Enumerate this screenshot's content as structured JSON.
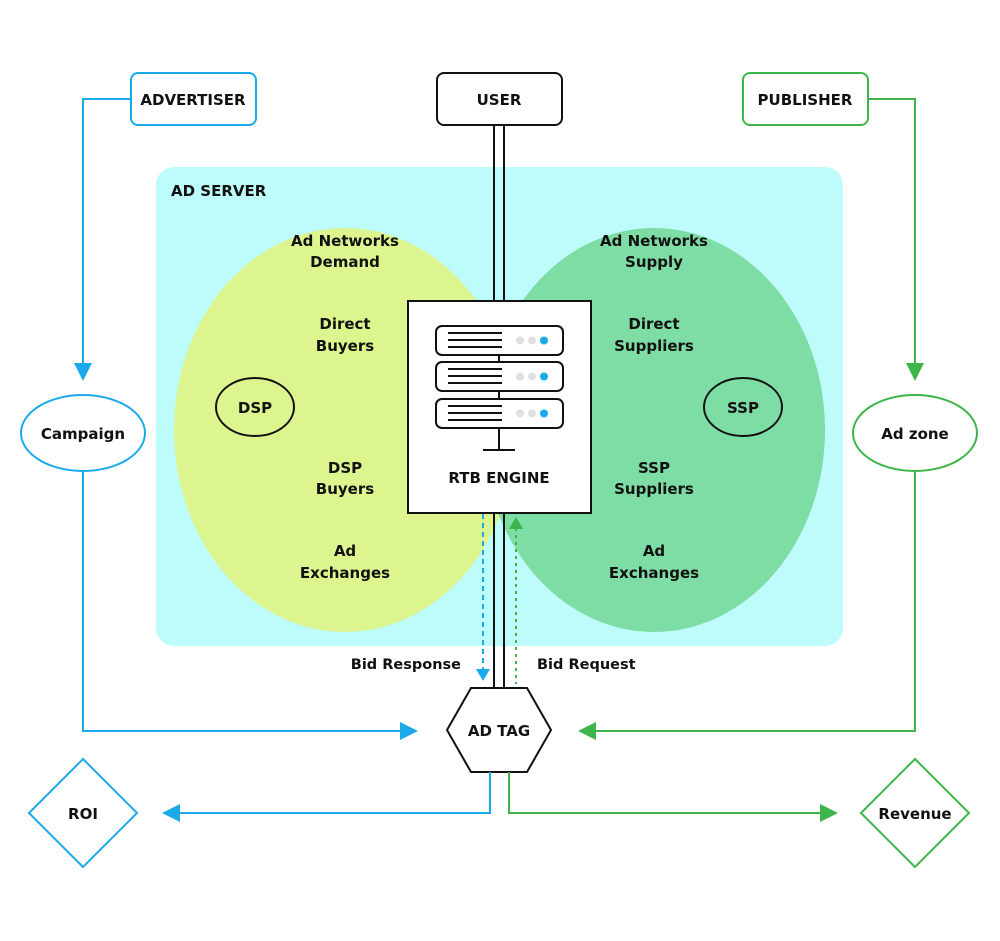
{
  "colors": {
    "blue": "#1AAAE9",
    "green": "#3DB54A",
    "ad_server_bg": "#BEFBFB",
    "demand_circle": "#DCF58F",
    "supply_circle": "#7EDCA5",
    "overlap": "#8DD777",
    "black": "#111111",
    "led_on": "#1AAAE9",
    "led_off": "#E0E0E0"
  },
  "nodes": {
    "advertiser": "ADVERTISER",
    "user": "USER",
    "publisher": "PUBLISHER",
    "campaign": "Campaign",
    "ad_zone": "Ad zone",
    "roi": "ROI",
    "revenue": "Revenue",
    "ad_tag": "AD TAG",
    "rtb_engine": "RTB ENGINE"
  },
  "ad_server": {
    "title": "AD SERVER",
    "demand": {
      "core": "DSP",
      "items": [
        [
          "Ad Networks",
          "Demand"
        ],
        [
          "Direct",
          "Buyers"
        ],
        [
          "DSP",
          "Buyers"
        ],
        [
          "Ad",
          "Exchanges"
        ]
      ]
    },
    "supply": {
      "core": "SSP",
      "items": [
        [
          "Ad Networks",
          "Supply"
        ],
        [
          "Direct",
          "Suppliers"
        ],
        [
          "SSP",
          "Suppliers"
        ],
        [
          "Ad",
          "Exchanges"
        ]
      ]
    }
  },
  "flows": {
    "bid_response": "Bid Response",
    "bid_request": "Bid Request"
  }
}
